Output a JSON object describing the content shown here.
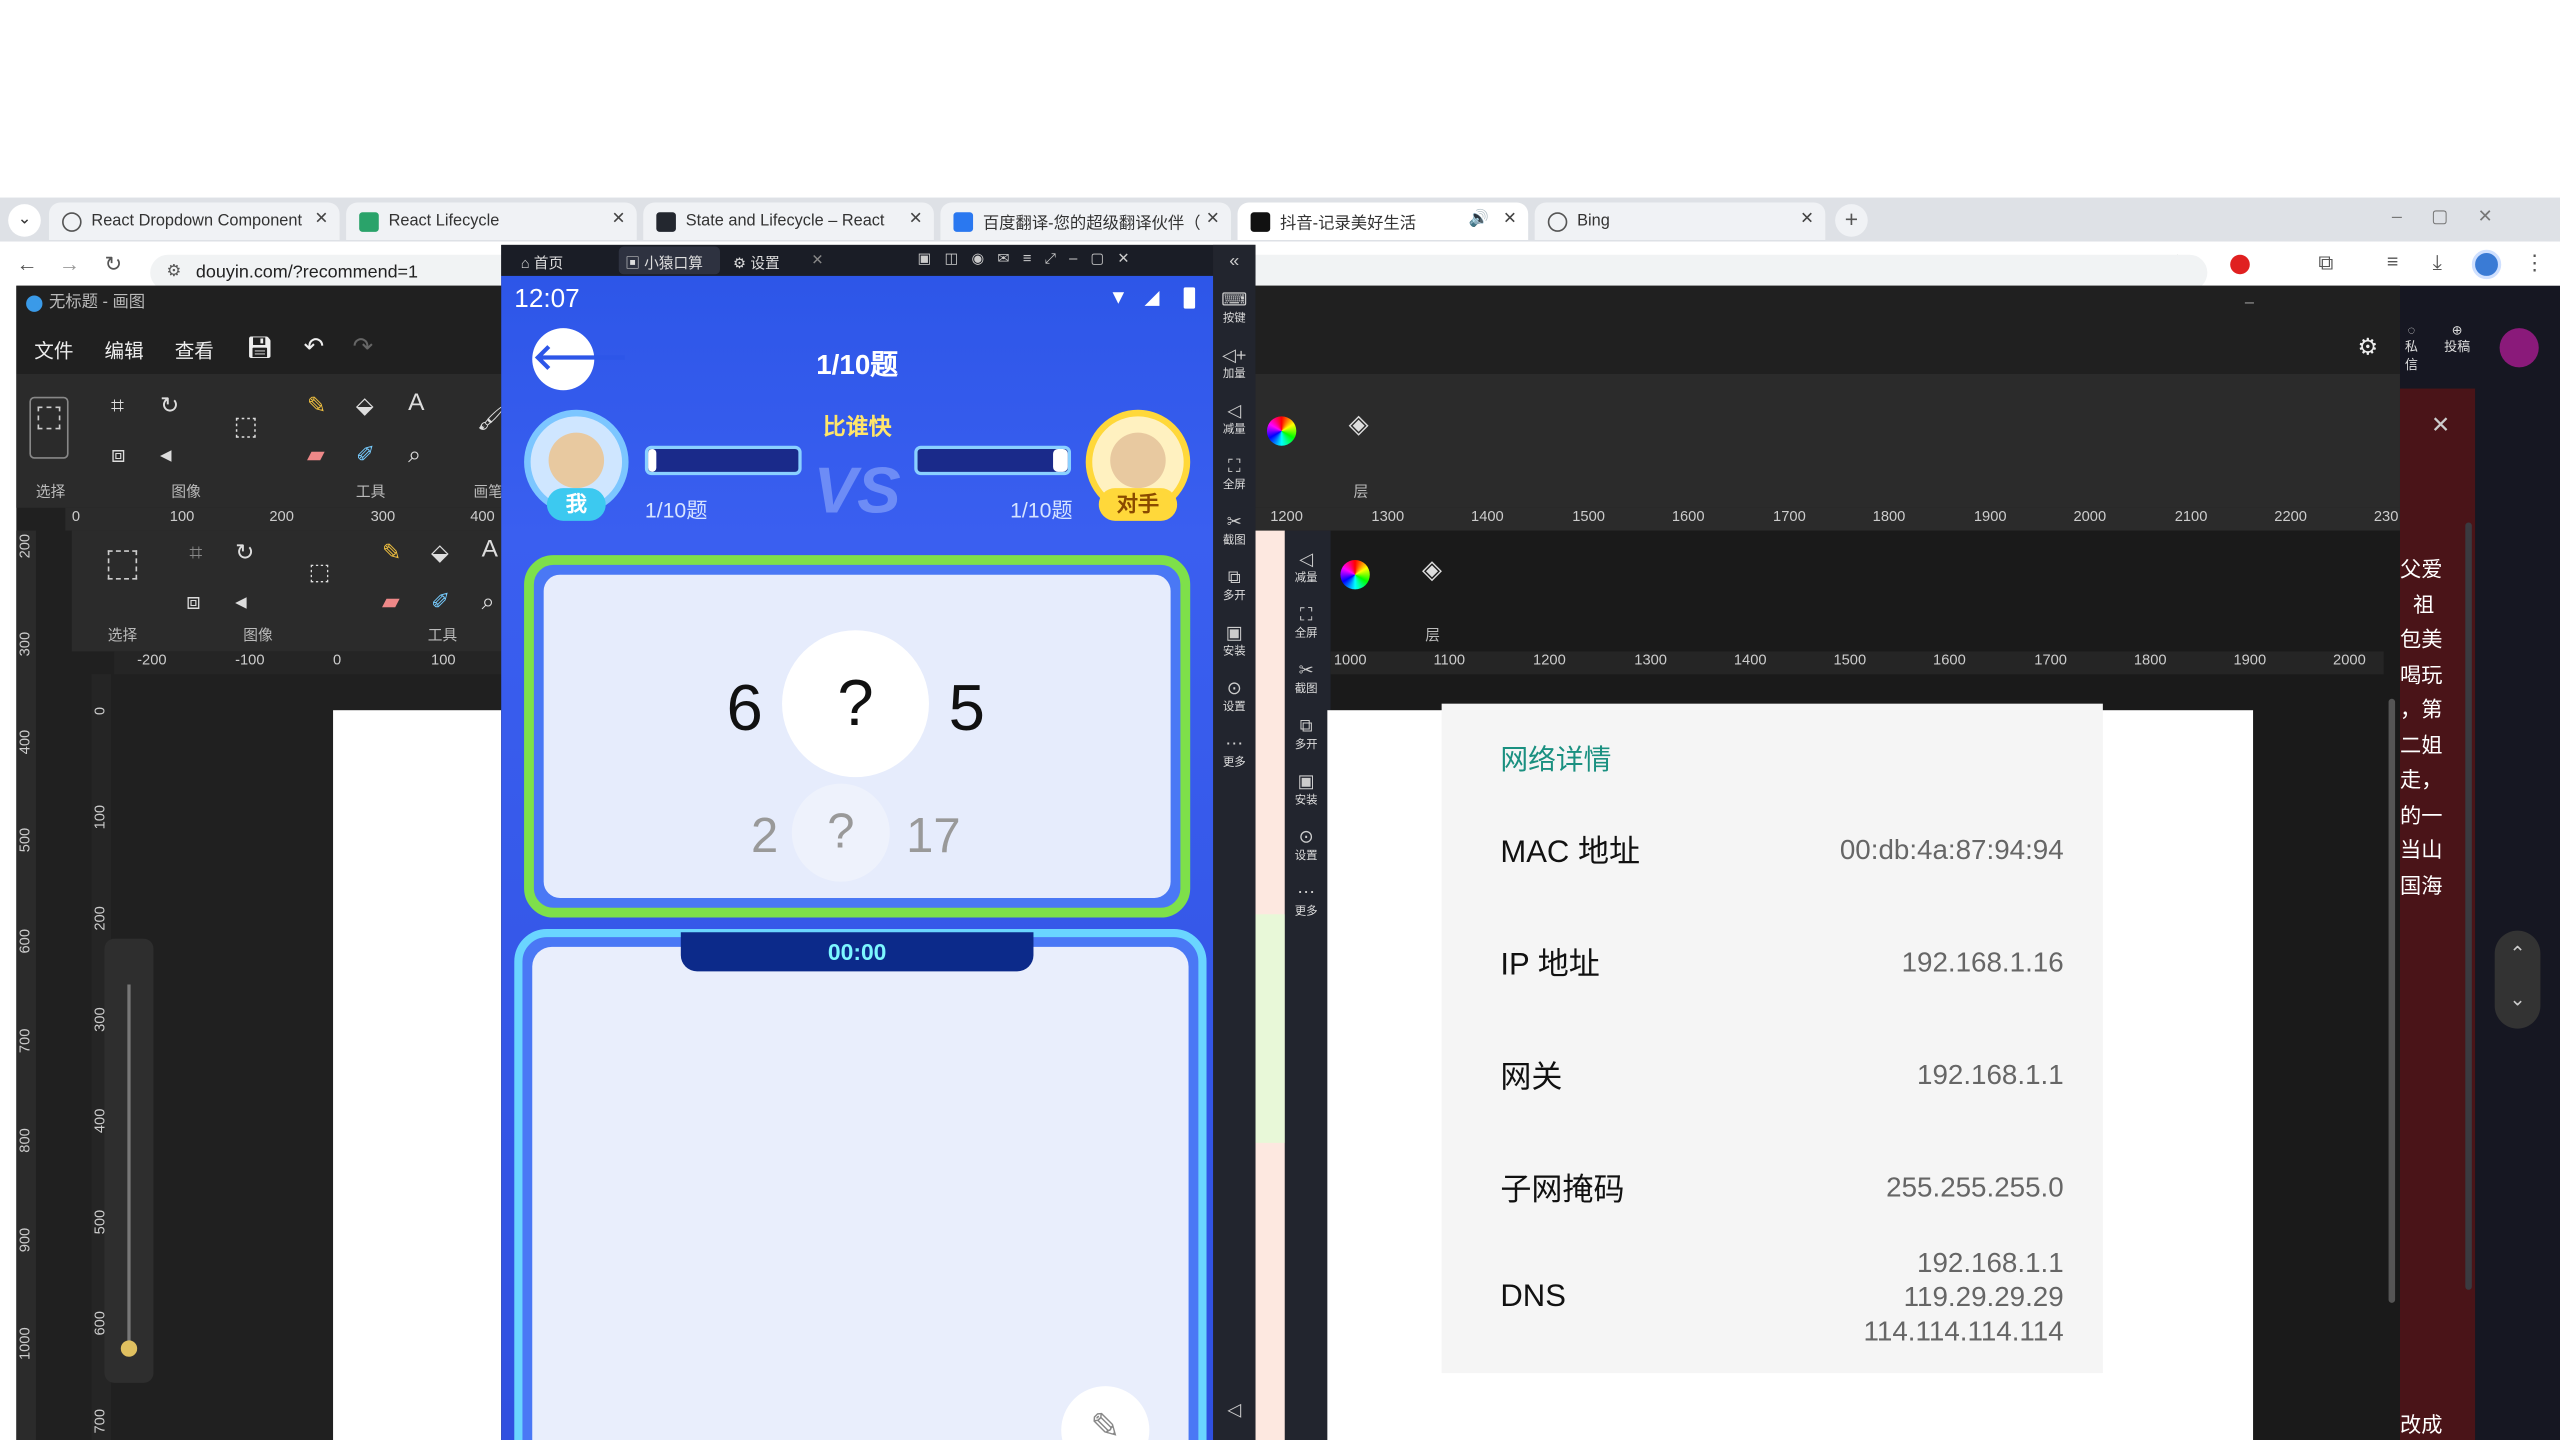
{
  "browser": {
    "tabs": [
      {
        "title": "React Dropdown Component",
        "icon": "react-icon"
      },
      {
        "title": "React Lifecycle",
        "icon": "w-icon"
      },
      {
        "title": "State and Lifecycle – React",
        "icon": "react-icon"
      },
      {
        "title": "百度翻译-您的超级翻译伙伴（",
        "icon": "translate-icon"
      },
      {
        "title": "抖音-记录美好生活",
        "icon": "tiktok-icon"
      },
      {
        "title": "Bing",
        "icon": "search-icon"
      }
    ],
    "url": "douyin.com/?recommend=1",
    "douyin_side": {
      "messages": "私信",
      "post": "投稿"
    },
    "douyin_text": [
      "父爱",
      "祖",
      "包美",
      "喝玩",
      "，第",
      "二姐",
      "走，",
      "的一",
      "当山",
      "国海"
    ],
    "douyin_bottom": "改成"
  },
  "paint": {
    "title": "无标题 - 画图",
    "menu": [
      "文件",
      "编辑",
      "查看"
    ],
    "groups": {
      "select": "选择",
      "image": "图像",
      "tools": "工具",
      "brush": "画笔",
      "layers": "层"
    },
    "ruler_top": [
      "0",
      "100",
      "200",
      "300",
      "400"
    ],
    "ruler_top_right": [
      "1200",
      "1300",
      "1400",
      "1500",
      "1600",
      "1700",
      "1800",
      "1900",
      "2000",
      "2100",
      "2200",
      "230"
    ],
    "ruler_left": [
      "200",
      "300",
      "400",
      "500",
      "600",
      "700",
      "800",
      "900",
      "1000"
    ],
    "inner_ruler_top": [
      "-200",
      "-100",
      "0",
      "100"
    ],
    "inner_ruler_top_right": [
      "1000",
      "1100",
      "1200",
      "1300",
      "1400",
      "1500",
      "1600",
      "1700",
      "1800",
      "1900",
      "2000"
    ],
    "inner_ruler_left": [
      "0",
      "100",
      "200",
      "300",
      "400",
      "500",
      "600",
      "700"
    ]
  },
  "emulator": {
    "tabs": [
      "首页",
      "小猿口算",
      "设置"
    ],
    "time": "12:07",
    "side_buttons": [
      "按键",
      "加量",
      "减量",
      "全屏",
      "截图",
      "多开",
      "安装",
      "设置",
      "更多"
    ],
    "side_buttons_inner": [
      "减量",
      "全屏",
      "截图",
      "多开",
      "安装",
      "设置",
      "更多"
    ]
  },
  "game": {
    "progress_title": "1/10题",
    "mode": "比谁快",
    "me_label": "我",
    "me_progress": "1/10题",
    "opponent_label": "对手",
    "opponent_progress": "1/10题",
    "q1_left": "6",
    "q1_op": "?",
    "q1_right": "5",
    "q2_left": "2",
    "q2_op": "?",
    "q2_right": "17",
    "timer": "00:00",
    "me_fill": 0.05,
    "opponent_fill": 0.05
  },
  "network": {
    "title": "网络详情",
    "rows": [
      {
        "key": "MAC 地址",
        "value": "00:db:4a:87:94:94"
      },
      {
        "key": "IP 地址",
        "value": "192.168.1.16"
      },
      {
        "key": "网关",
        "value": "192.168.1.1"
      },
      {
        "key": "子网掩码",
        "value": "255.255.255.0"
      },
      {
        "key": "DNS",
        "values": [
          "192.168.1.1",
          "119.29.29.29",
          "114.114.114.114"
        ]
      }
    ]
  },
  "colors": {
    "accent_teal": "#1a9080",
    "game_blue": "#3a5ff0",
    "card_green": "#7ee04a",
    "chrome_bg": "#dee1e6"
  }
}
